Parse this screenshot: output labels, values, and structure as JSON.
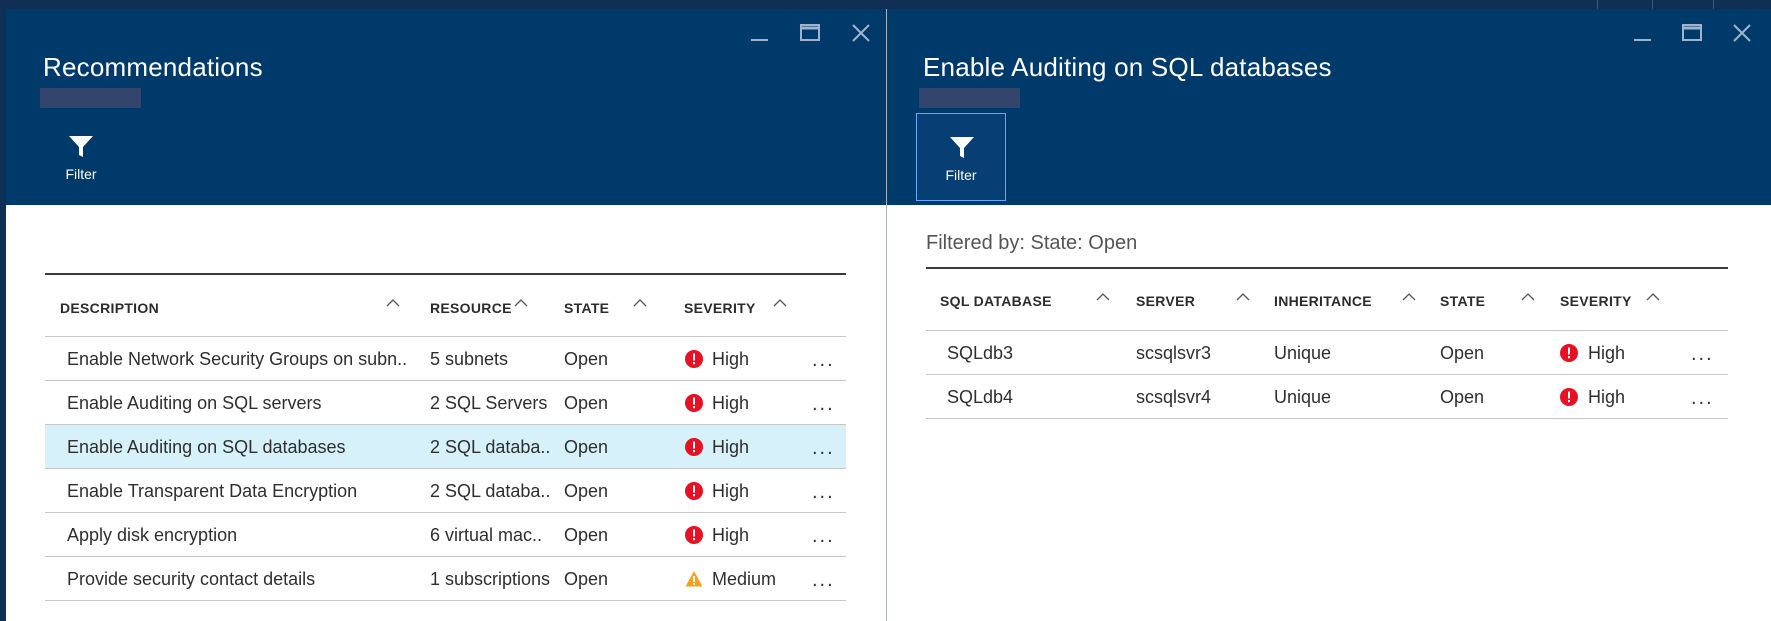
{
  "left_blade": {
    "title": "Recommendations",
    "command": {
      "label": "Filter",
      "icon": "filter-icon"
    },
    "table": {
      "headers": [
        "DESCRIPTION",
        "RESOURCE",
        "STATE",
        "SEVERITY"
      ],
      "rows": [
        {
          "description": "Enable Network Security Groups on subn..",
          "resource": "5 subnets",
          "state": "Open",
          "severity": "High",
          "severity_icon": "error-icon"
        },
        {
          "description": "Enable Auditing on SQL servers",
          "resource": "2 SQL Servers",
          "state": "Open",
          "severity": "High",
          "severity_icon": "error-icon"
        },
        {
          "description": "Enable Auditing on SQL databases",
          "resource": "2 SQL databa..",
          "state": "Open",
          "severity": "High",
          "severity_icon": "error-icon",
          "selected": true
        },
        {
          "description": "Enable Transparent Data Encryption",
          "resource": "2 SQL databa..",
          "state": "Open",
          "severity": "High",
          "severity_icon": "error-icon"
        },
        {
          "description": "Apply disk encryption",
          "resource": "6 virtual mac..",
          "state": "Open",
          "severity": "High",
          "severity_icon": "error-icon"
        },
        {
          "description": "Provide security contact details",
          "resource": "1 subscriptions",
          "state": "Open",
          "severity": "Medium",
          "severity_icon": "warning-icon"
        }
      ],
      "more_label": "..."
    }
  },
  "right_blade": {
    "title": "Enable Auditing on SQL databases",
    "command": {
      "label": "Filter",
      "icon": "filter-icon"
    },
    "filtered_by": "Filtered by: State: Open",
    "table": {
      "headers": [
        "SQL DATABASE",
        "SERVER",
        "INHERITANCE",
        "STATE",
        "SEVERITY"
      ],
      "rows": [
        {
          "database": "SQLdb3",
          "server": "scsqlsvr3",
          "inheritance": "Unique",
          "state": "Open",
          "severity": "High",
          "severity_icon": "error-icon"
        },
        {
          "database": "SQLdb4",
          "server": "scsqlsvr4",
          "inheritance": "Unique",
          "state": "Open",
          "severity": "High",
          "severity_icon": "error-icon"
        }
      ],
      "more_label": "..."
    }
  },
  "colors": {
    "header_bg": "#003a6b",
    "selected_row": "#d6f1fa",
    "high_severity": "#e81123",
    "medium_severity": "#f7a21b"
  }
}
